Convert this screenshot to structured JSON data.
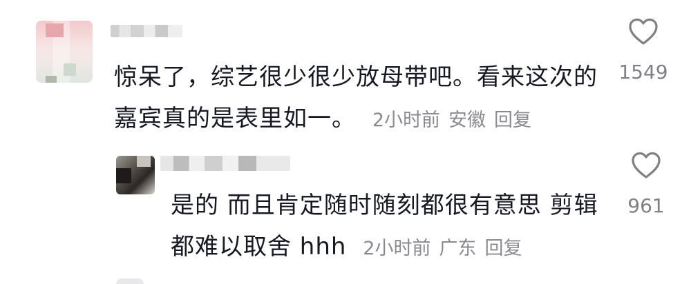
{
  "comments": [
    {
      "text": "惊呆了，综艺很少很少放母带吧。看来这次的嘉宾真的是表里如一。",
      "time": "2小时前",
      "location": "安徽",
      "reply_label": "回复",
      "likes": "1549"
    }
  ],
  "reply": {
    "text": "是的 而且肯定随时随刻都很有意思 剪辑都难以取舍 hhh",
    "time": "2小时前",
    "location": "广东",
    "reply_label": "回复",
    "likes": "961"
  },
  "icons": {
    "like": "heart-outline-icon"
  },
  "colors": {
    "text_primary": "#161823",
    "text_meta": "#8a8b91",
    "icon": "#7f8086"
  }
}
